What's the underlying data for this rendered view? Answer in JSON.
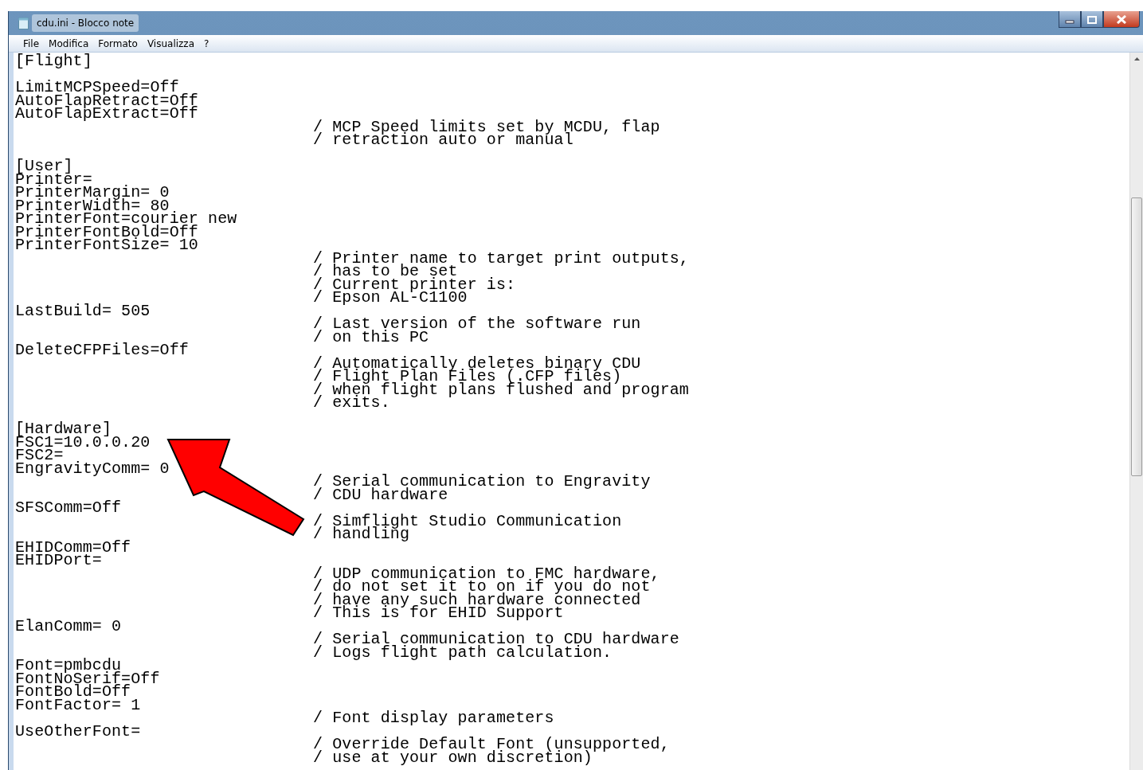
{
  "window": {
    "title": "cdu.ini - Blocco note"
  },
  "menu": [
    {
      "label": "File"
    },
    {
      "label": "Modifica"
    },
    {
      "label": "Formato"
    },
    {
      "label": "Visualizza"
    },
    {
      "label": "?"
    }
  ],
  "lines": [
    {
      "kind": "section",
      "text": "[Flight]"
    },
    {
      "kind": "blank"
    },
    {
      "kind": "setting",
      "text": "LimitMCPSpeed=Off"
    },
    {
      "kind": "setting",
      "text": "AutoFlapRetract=Off"
    },
    {
      "kind": "setting",
      "text": "AutoFlapExtract=Off"
    },
    {
      "kind": "comment",
      "text": "/ MCP Speed limits set by MCDU, flap"
    },
    {
      "kind": "comment",
      "text": "/ retraction auto or manual"
    },
    {
      "kind": "blank"
    },
    {
      "kind": "section",
      "text": "[User]"
    },
    {
      "kind": "setting",
      "text": "Printer="
    },
    {
      "kind": "setting",
      "text": "PrinterMargin= 0"
    },
    {
      "kind": "setting",
      "text": "PrinterWidth= 80"
    },
    {
      "kind": "setting",
      "text": "PrinterFont=courier new"
    },
    {
      "kind": "setting",
      "text": "PrinterFontBold=Off"
    },
    {
      "kind": "setting",
      "text": "PrinterFontSize= 10"
    },
    {
      "kind": "comment",
      "text": "/ Printer name to target print outputs,"
    },
    {
      "kind": "comment",
      "text": "/ has to be set"
    },
    {
      "kind": "comment",
      "text": "/ Current printer is:"
    },
    {
      "kind": "comment",
      "text": "/ Epson AL-C1100"
    },
    {
      "kind": "setting",
      "text": "LastBuild= 505"
    },
    {
      "kind": "comment",
      "text": "/ Last version of the software run"
    },
    {
      "kind": "comment",
      "text": "/ on this PC"
    },
    {
      "kind": "setting",
      "text": "DeleteCFPFiles=Off"
    },
    {
      "kind": "comment",
      "text": "/ Automatically deletes binary CDU"
    },
    {
      "kind": "comment",
      "text": "/ Flight Plan Files (.CFP files)"
    },
    {
      "kind": "comment",
      "text": "/ when flight plans flushed and program"
    },
    {
      "kind": "comment",
      "text": "/ exits."
    },
    {
      "kind": "blank"
    },
    {
      "kind": "section",
      "text": "[Hardware]"
    },
    {
      "kind": "setting",
      "text": "FSC1=10.0.0.20"
    },
    {
      "kind": "setting",
      "text": "FSC2="
    },
    {
      "kind": "setting",
      "text": "EngravityComm= 0"
    },
    {
      "kind": "comment",
      "text": "/ Serial communication to Engravity"
    },
    {
      "kind": "comment",
      "text": "/ CDU hardware"
    },
    {
      "kind": "setting",
      "text": "SFSComm=Off"
    },
    {
      "kind": "comment",
      "text": "/ Simflight Studio Communication"
    },
    {
      "kind": "comment",
      "text": "/ handling"
    },
    {
      "kind": "setting",
      "text": "EHIDComm=Off"
    },
    {
      "kind": "setting",
      "text": "EHIDPort="
    },
    {
      "kind": "comment",
      "text": "/ UDP communication to FMC hardware,"
    },
    {
      "kind": "comment",
      "text": "/ do not set it to on if you do not"
    },
    {
      "kind": "comment",
      "text": "/ have any such hardware connected"
    },
    {
      "kind": "comment",
      "text": "/ This is for EHID Support"
    },
    {
      "kind": "setting",
      "text": "ElanComm= 0"
    },
    {
      "kind": "comment",
      "text": "/ Serial communication to CDU hardware"
    },
    {
      "kind": "comment",
      "text": "/ Logs flight path calculation."
    },
    {
      "kind": "setting",
      "text": "Font=pmbcdu"
    },
    {
      "kind": "setting",
      "text": "FontNoSerif=Off"
    },
    {
      "kind": "setting",
      "text": "FontBold=Off"
    },
    {
      "kind": "setting",
      "text": "FontFactor= 1"
    },
    {
      "kind": "comment",
      "text": "/ Font display parameters"
    },
    {
      "kind": "setting",
      "text": "UseOtherFont="
    },
    {
      "kind": "comment",
      "text": "/ Override Default Font (unsupported,"
    },
    {
      "kind": "comment",
      "text": "/ use at your own discretion)"
    }
  ]
}
